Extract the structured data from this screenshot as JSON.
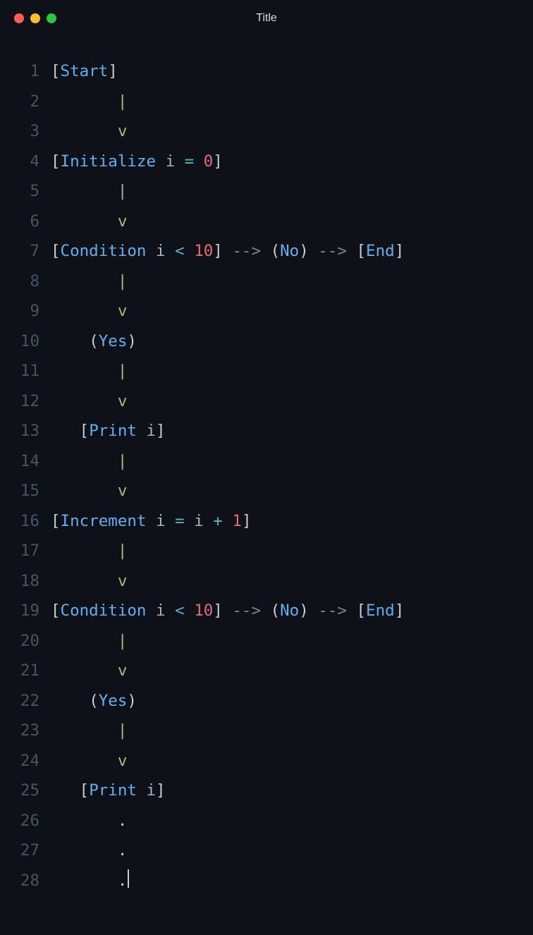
{
  "window": {
    "title": "Title"
  },
  "colors": {
    "bg": "#0e1117",
    "gutter": "#4b5263",
    "plain": "#c8ccd4",
    "ident": "#61afef",
    "op": "#56b6c2",
    "num": "#d19a66",
    "numred": "#e06c75",
    "pipe": "#98c379",
    "arrow": "#7f848e"
  },
  "editor": {
    "cursor_line": 28,
    "lines": [
      {
        "n": 1,
        "tokens": [
          {
            "t": "[",
            "c": "bracket"
          },
          {
            "t": "Start",
            "c": "ident"
          },
          {
            "t": "]",
            "c": "bracket"
          }
        ]
      },
      {
        "n": 2,
        "tokens": [
          {
            "t": "       ",
            "c": "plain"
          },
          {
            "t": "|",
            "c": "pipe"
          }
        ]
      },
      {
        "n": 3,
        "tokens": [
          {
            "t": "       ",
            "c": "plain"
          },
          {
            "t": "v",
            "c": "v"
          }
        ]
      },
      {
        "n": 4,
        "tokens": [
          {
            "t": "[",
            "c": "bracket"
          },
          {
            "t": "Initialize",
            "c": "ident"
          },
          {
            "t": " ",
            "c": "plain"
          },
          {
            "t": "i",
            "c": "var"
          },
          {
            "t": " ",
            "c": "plain"
          },
          {
            "t": "=",
            "c": "op"
          },
          {
            "t": " ",
            "c": "plain"
          },
          {
            "t": "0",
            "c": "numred"
          },
          {
            "t": "]",
            "c": "bracket"
          }
        ]
      },
      {
        "n": 5,
        "tokens": [
          {
            "t": "       ",
            "c": "plain"
          },
          {
            "t": "|",
            "c": "pipe"
          }
        ]
      },
      {
        "n": 6,
        "tokens": [
          {
            "t": "       ",
            "c": "plain"
          },
          {
            "t": "v",
            "c": "v"
          }
        ]
      },
      {
        "n": 7,
        "tokens": [
          {
            "t": "[",
            "c": "bracket"
          },
          {
            "t": "Condition",
            "c": "ident"
          },
          {
            "t": " ",
            "c": "plain"
          },
          {
            "t": "i",
            "c": "var"
          },
          {
            "t": " ",
            "c": "plain"
          },
          {
            "t": "<",
            "c": "op"
          },
          {
            "t": " ",
            "c": "plain"
          },
          {
            "t": "10",
            "c": "numred"
          },
          {
            "t": "]",
            "c": "bracket"
          },
          {
            "t": " ",
            "c": "plain"
          },
          {
            "t": "-->",
            "c": "arrow"
          },
          {
            "t": " ",
            "c": "plain"
          },
          {
            "t": "(",
            "c": "paren"
          },
          {
            "t": "No",
            "c": "word"
          },
          {
            "t": ")",
            "c": "paren"
          },
          {
            "t": " ",
            "c": "plain"
          },
          {
            "t": "-->",
            "c": "arrow"
          },
          {
            "t": " ",
            "c": "plain"
          },
          {
            "t": "[",
            "c": "bracket"
          },
          {
            "t": "End",
            "c": "ident"
          },
          {
            "t": "]",
            "c": "bracket"
          }
        ]
      },
      {
        "n": 8,
        "tokens": [
          {
            "t": "       ",
            "c": "plain"
          },
          {
            "t": "|",
            "c": "pipe"
          }
        ]
      },
      {
        "n": 9,
        "tokens": [
          {
            "t": "       ",
            "c": "plain"
          },
          {
            "t": "v",
            "c": "v"
          }
        ]
      },
      {
        "n": 10,
        "tokens": [
          {
            "t": "    ",
            "c": "plain"
          },
          {
            "t": "(",
            "c": "paren"
          },
          {
            "t": "Yes",
            "c": "word"
          },
          {
            "t": ")",
            "c": "paren"
          }
        ]
      },
      {
        "n": 11,
        "tokens": [
          {
            "t": "       ",
            "c": "plain"
          },
          {
            "t": "|",
            "c": "pipe"
          }
        ]
      },
      {
        "n": 12,
        "tokens": [
          {
            "t": "       ",
            "c": "plain"
          },
          {
            "t": "v",
            "c": "v"
          }
        ]
      },
      {
        "n": 13,
        "tokens": [
          {
            "t": "   ",
            "c": "plain"
          },
          {
            "t": "[",
            "c": "bracket"
          },
          {
            "t": "Print",
            "c": "ident"
          },
          {
            "t": " ",
            "c": "plain"
          },
          {
            "t": "i",
            "c": "var"
          },
          {
            "t": "]",
            "c": "bracket"
          }
        ]
      },
      {
        "n": 14,
        "tokens": [
          {
            "t": "       ",
            "c": "plain"
          },
          {
            "t": "|",
            "c": "pipe"
          }
        ]
      },
      {
        "n": 15,
        "tokens": [
          {
            "t": "       ",
            "c": "plain"
          },
          {
            "t": "v",
            "c": "v"
          }
        ]
      },
      {
        "n": 16,
        "tokens": [
          {
            "t": "[",
            "c": "bracket"
          },
          {
            "t": "Increment",
            "c": "ident"
          },
          {
            "t": " ",
            "c": "plain"
          },
          {
            "t": "i",
            "c": "var"
          },
          {
            "t": " ",
            "c": "plain"
          },
          {
            "t": "=",
            "c": "op"
          },
          {
            "t": " ",
            "c": "plain"
          },
          {
            "t": "i",
            "c": "var"
          },
          {
            "t": " ",
            "c": "plain"
          },
          {
            "t": "+",
            "c": "op"
          },
          {
            "t": " ",
            "c": "plain"
          },
          {
            "t": "1",
            "c": "numred"
          },
          {
            "t": "]",
            "c": "bracket"
          }
        ]
      },
      {
        "n": 17,
        "tokens": [
          {
            "t": "       ",
            "c": "plain"
          },
          {
            "t": "|",
            "c": "pipe"
          }
        ]
      },
      {
        "n": 18,
        "tokens": [
          {
            "t": "       ",
            "c": "plain"
          },
          {
            "t": "v",
            "c": "v"
          }
        ]
      },
      {
        "n": 19,
        "tokens": [
          {
            "t": "[",
            "c": "bracket"
          },
          {
            "t": "Condition",
            "c": "ident"
          },
          {
            "t": " ",
            "c": "plain"
          },
          {
            "t": "i",
            "c": "var"
          },
          {
            "t": " ",
            "c": "plain"
          },
          {
            "t": "<",
            "c": "op"
          },
          {
            "t": " ",
            "c": "plain"
          },
          {
            "t": "10",
            "c": "numred"
          },
          {
            "t": "]",
            "c": "bracket"
          },
          {
            "t": " ",
            "c": "plain"
          },
          {
            "t": "-->",
            "c": "arrow"
          },
          {
            "t": " ",
            "c": "plain"
          },
          {
            "t": "(",
            "c": "paren"
          },
          {
            "t": "No",
            "c": "word"
          },
          {
            "t": ")",
            "c": "paren"
          },
          {
            "t": " ",
            "c": "plain"
          },
          {
            "t": "-->",
            "c": "arrow"
          },
          {
            "t": " ",
            "c": "plain"
          },
          {
            "t": "[",
            "c": "bracket"
          },
          {
            "t": "End",
            "c": "ident"
          },
          {
            "t": "]",
            "c": "bracket"
          }
        ]
      },
      {
        "n": 20,
        "tokens": [
          {
            "t": "       ",
            "c": "plain"
          },
          {
            "t": "|",
            "c": "pipe"
          }
        ]
      },
      {
        "n": 21,
        "tokens": [
          {
            "t": "       ",
            "c": "plain"
          },
          {
            "t": "v",
            "c": "v"
          }
        ]
      },
      {
        "n": 22,
        "tokens": [
          {
            "t": "    ",
            "c": "plain"
          },
          {
            "t": "(",
            "c": "paren"
          },
          {
            "t": "Yes",
            "c": "word"
          },
          {
            "t": ")",
            "c": "paren"
          }
        ]
      },
      {
        "n": 23,
        "tokens": [
          {
            "t": "       ",
            "c": "plain"
          },
          {
            "t": "|",
            "c": "pipe"
          }
        ]
      },
      {
        "n": 24,
        "tokens": [
          {
            "t": "       ",
            "c": "plain"
          },
          {
            "t": "v",
            "c": "v"
          }
        ]
      },
      {
        "n": 25,
        "tokens": [
          {
            "t": "   ",
            "c": "plain"
          },
          {
            "t": "[",
            "c": "bracket"
          },
          {
            "t": "Print",
            "c": "ident"
          },
          {
            "t": " ",
            "c": "plain"
          },
          {
            "t": "i",
            "c": "var"
          },
          {
            "t": "]",
            "c": "bracket"
          }
        ]
      },
      {
        "n": 26,
        "tokens": [
          {
            "t": "       ",
            "c": "plain"
          },
          {
            "t": ".",
            "c": "dot"
          }
        ]
      },
      {
        "n": 27,
        "tokens": [
          {
            "t": "       ",
            "c": "plain"
          },
          {
            "t": ".",
            "c": "dot"
          }
        ]
      },
      {
        "n": 28,
        "tokens": [
          {
            "t": "       ",
            "c": "plain"
          },
          {
            "t": ".",
            "c": "dot"
          }
        ],
        "cursor_after": true
      }
    ]
  }
}
